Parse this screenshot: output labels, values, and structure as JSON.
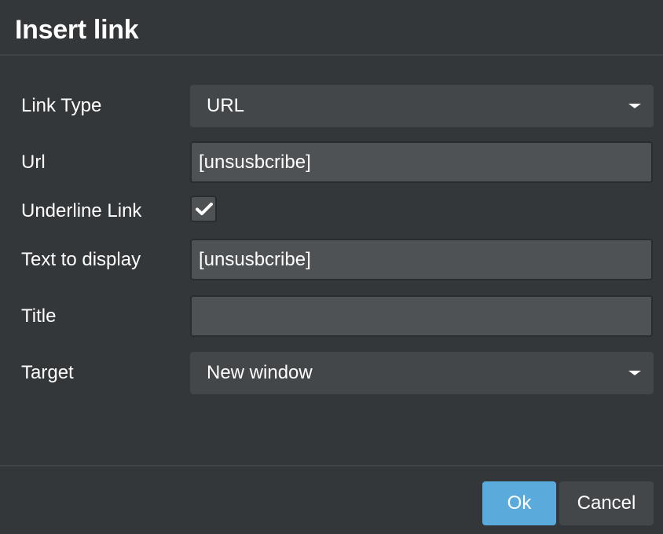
{
  "dialog": {
    "title": "Insert link"
  },
  "form": {
    "link_type": {
      "label": "Link Type",
      "value": "URL"
    },
    "url": {
      "label": "Url",
      "value": "[unsusbcribe]"
    },
    "underline": {
      "label": "Underline Link",
      "checked": true
    },
    "text_to_display": {
      "label": "Text to display",
      "value": "[unsusbcribe]"
    },
    "title": {
      "label": "Title",
      "value": ""
    },
    "target": {
      "label": "Target",
      "value": "New window"
    }
  },
  "footer": {
    "ok_label": "Ok",
    "cancel_label": "Cancel"
  },
  "colors": {
    "dialog_bg": "#33373a",
    "field_bg": "#4e5255",
    "select_bg": "#43474a",
    "primary": "#5aabdb",
    "text": "#ffffff"
  },
  "icons": {
    "checkbox_mark": "checkmark-icon",
    "dropdown": "caret-down-icon"
  }
}
